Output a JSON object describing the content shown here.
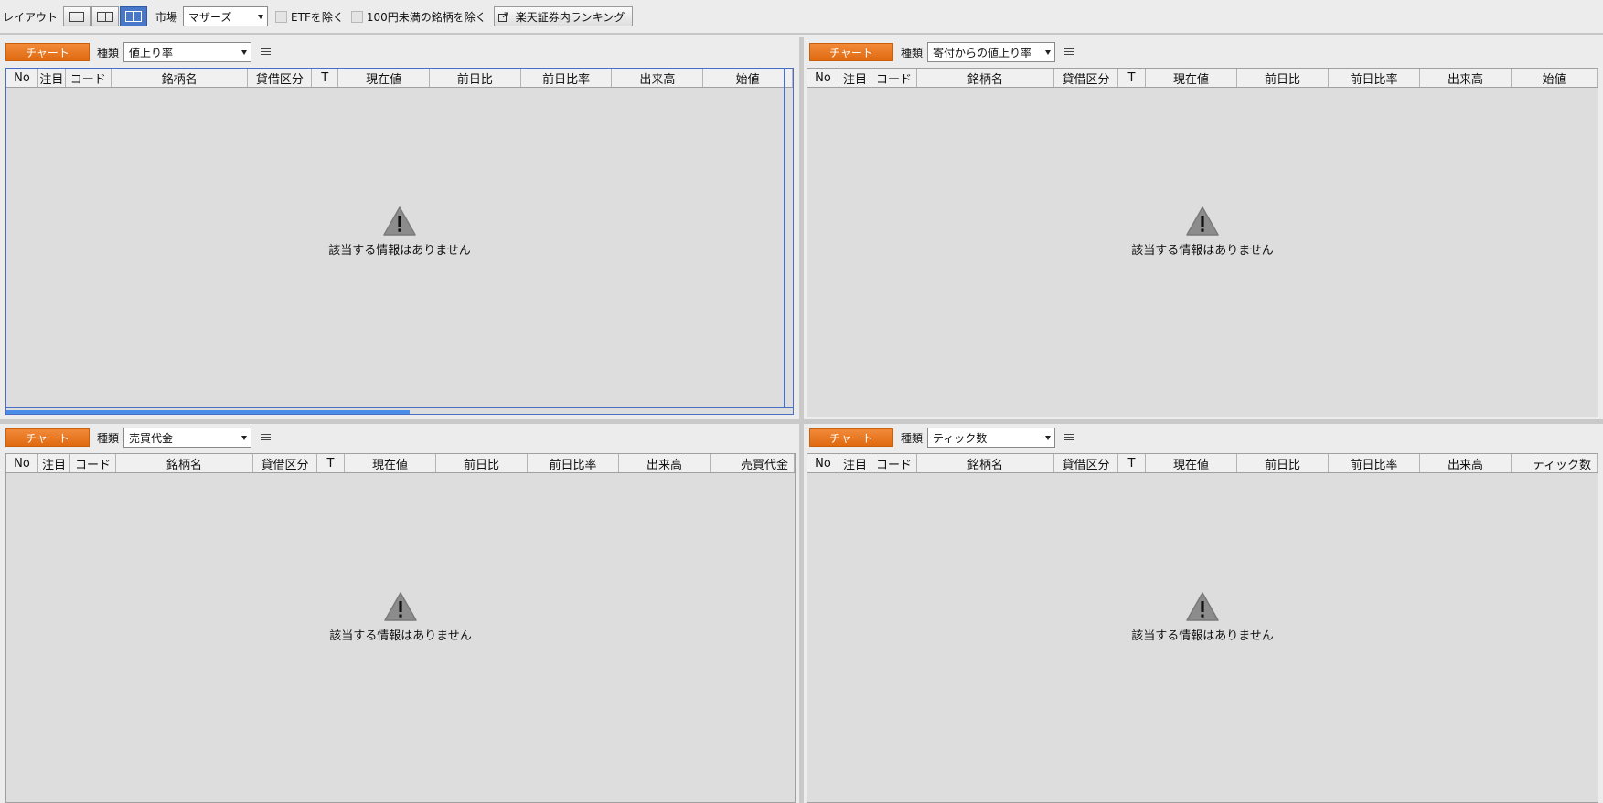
{
  "toolbar": {
    "layout_label": "レイアウト",
    "market_label": "市場",
    "market_value": "マザーズ",
    "exclude_etf_label": "ETFを除く",
    "exclude_under100_label": "100円未満の銘柄を除く",
    "ranking_button_label": "楽天証券内ランキング"
  },
  "panels": [
    {
      "chart_button": "チャート",
      "type_label": "種類",
      "type_value": "値上り率",
      "columns": [
        "No",
        "注目",
        "コード",
        "銘柄名",
        "貸借区分",
        "T",
        "現在値",
        "前日比",
        "前日比率",
        "出来高",
        "始値"
      ],
      "empty_message": "該当する情報はありません"
    },
    {
      "chart_button": "チャート",
      "type_label": "種類",
      "type_value": "寄付からの値上り率",
      "columns": [
        "No",
        "注目",
        "コード",
        "銘柄名",
        "貸借区分",
        "T",
        "現在値",
        "前日比",
        "前日比率",
        "出来高",
        "始値"
      ],
      "empty_message": "該当する情報はありません"
    },
    {
      "chart_button": "チャート",
      "type_label": "種類",
      "type_value": "売買代金",
      "columns": [
        "No",
        "注目",
        "コード",
        "銘柄名",
        "貸借区分",
        "T",
        "現在値",
        "前日比",
        "前日比率",
        "出来高",
        "売買代金"
      ],
      "empty_message": "該当する情報はありません"
    },
    {
      "chart_button": "チャート",
      "type_label": "種類",
      "type_value": "ティック数",
      "columns": [
        "No",
        "注目",
        "コード",
        "銘柄名",
        "貸借区分",
        "T",
        "現在値",
        "前日比",
        "前日比率",
        "出来高",
        "ティック数"
      ],
      "empty_message": "該当する情報はありません"
    }
  ],
  "colors": {
    "chart_button": "#e8781e",
    "layout_active": "#4a78c8",
    "focus_frame": "#4a6fc2"
  },
  "icons": {
    "layout_single": "layout-single-icon",
    "layout_dual": "layout-dual-icon",
    "layout_quad": "layout-quad-icon",
    "external": "external-link-icon",
    "menu": "hamburger-menu-icon",
    "warning": "warning-icon"
  }
}
